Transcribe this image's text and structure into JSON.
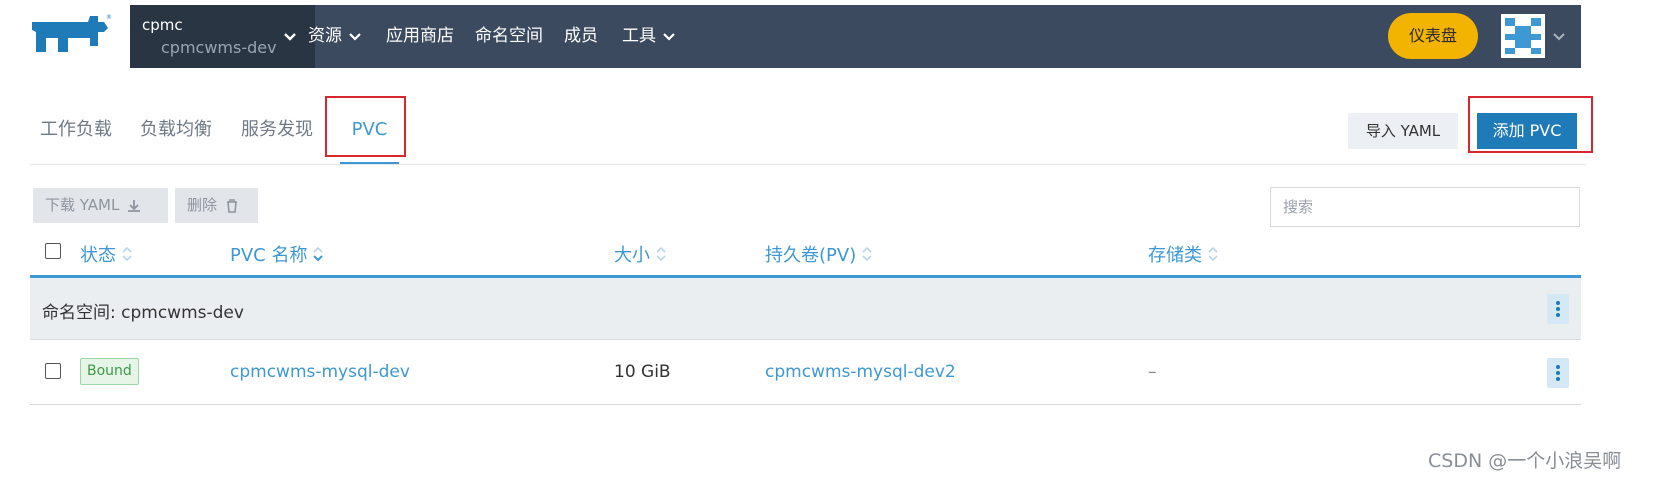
{
  "nav": {
    "project_name": "cpmc",
    "namespace_name": "cpmcwms-dev",
    "items": [
      {
        "label": "资源",
        "has_dropdown": true
      },
      {
        "label": "应用商店",
        "has_dropdown": false
      },
      {
        "label": "命名空间",
        "has_dropdown": false
      },
      {
        "label": "成员",
        "has_dropdown": false
      },
      {
        "label": "工具",
        "has_dropdown": true
      }
    ],
    "dashboard_label": "仪表盘",
    "accent_color": "#f2b301",
    "bar_color": "#3b4a5e"
  },
  "tabs": [
    {
      "label": "工作负载",
      "active": false
    },
    {
      "label": "负载均衡",
      "active": false
    },
    {
      "label": "服务发现",
      "active": false
    },
    {
      "label": "PVC",
      "active": true
    }
  ],
  "actions": {
    "import_yaml": "导入 YAML",
    "add_pvc": "添加 PVC",
    "download_yaml": "下载 YAML",
    "delete": "删除",
    "search_placeholder": "搜索"
  },
  "table": {
    "columns": [
      "状态",
      "PVC 名称",
      "大小",
      "持久卷(PV)",
      "存储类"
    ],
    "group_label": "命名空间: cpmcwms-dev",
    "rows": [
      {
        "state": "Bound",
        "name": "cpmcwms-mysql-dev",
        "size": "10 GiB",
        "pv": "cpmcwms-mysql-dev2",
        "storage_class": "–"
      }
    ]
  },
  "watermark": "CSDN @一个小浪吴啊"
}
